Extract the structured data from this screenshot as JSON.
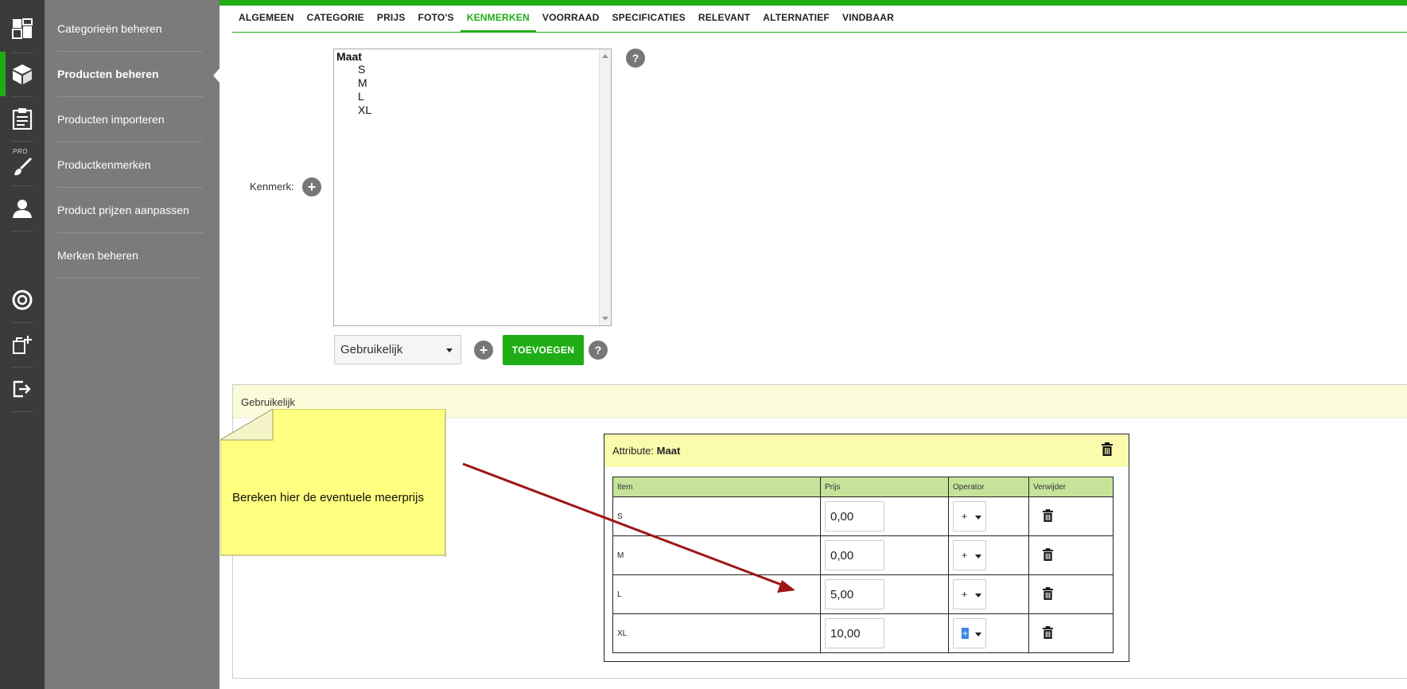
{
  "sidebar_icons": [
    {
      "name": "dashboard-icon"
    },
    {
      "name": "products-icon",
      "active": true
    },
    {
      "name": "clipboard-icon"
    },
    {
      "name": "brush-icon",
      "tag": "PRO"
    },
    {
      "name": "user-icon"
    },
    {
      "name": "help-ring-icon"
    },
    {
      "name": "export-icon"
    },
    {
      "name": "logout-icon"
    }
  ],
  "subnav": {
    "items": [
      {
        "label": "Categorieën beheren"
      },
      {
        "label": "Producten beheren",
        "active": true
      },
      {
        "label": "Producten importeren"
      },
      {
        "label": "Productkenmerken"
      },
      {
        "label": "Product prijzen aanpassen"
      },
      {
        "label": "Merken beheren"
      }
    ]
  },
  "tabs": [
    {
      "label": "ALGEMEEN"
    },
    {
      "label": "CATEGORIE"
    },
    {
      "label": "PRIJS"
    },
    {
      "label": "FOTO'S"
    },
    {
      "label": "KENMERKEN",
      "active": true
    },
    {
      "label": "VOORRAAD"
    },
    {
      "label": "SPECIFICATIES"
    },
    {
      "label": "RELEVANT"
    },
    {
      "label": "ALTERNATIEF"
    },
    {
      "label": "VINDBAAR"
    }
  ],
  "kenmerk": {
    "label": "Kenmerk:",
    "group": "Maat",
    "options": [
      "S",
      "M",
      "L",
      "XL"
    ]
  },
  "controls": {
    "select_value": "Gebruikelijk",
    "add_label": "TOEVOEGEN"
  },
  "panel": {
    "title": "Gebruikelijk"
  },
  "attribute": {
    "prefix": "Attribute:",
    "name": "Maat",
    "headers": [
      "Item",
      "Prijs",
      "Operator",
      "Verwijder"
    ],
    "rows": [
      {
        "item": "S",
        "price": "0,00",
        "operator": "+"
      },
      {
        "item": "M",
        "price": "0,00",
        "operator": "+"
      },
      {
        "item": "L",
        "price": "5,00",
        "operator": "+"
      },
      {
        "item": "XL",
        "price": "10,00",
        "operator": "+"
      }
    ]
  },
  "annotation": {
    "text": "Bereken hier de eventuele meerprijs"
  },
  "colors": {
    "accent": "#1fad16",
    "rail": "#3b3b3b",
    "subnav": "#7b7b7b",
    "note": "#ffff80",
    "arrow": "#a01414"
  }
}
